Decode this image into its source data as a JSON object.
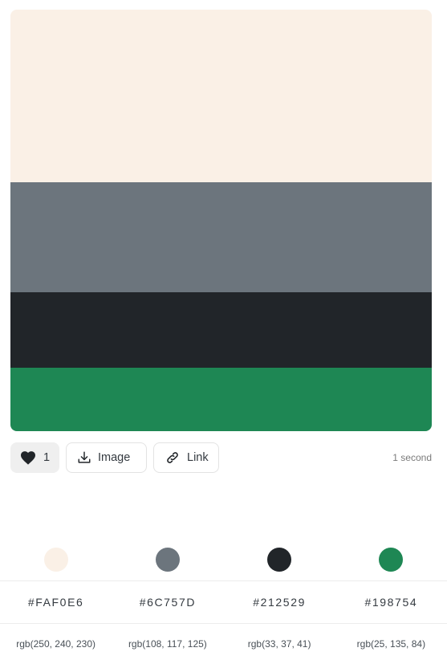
{
  "palette": {
    "colors": [
      {
        "hex": "#FAF0E6",
        "fill": "#FAF0E6",
        "rgb": "rgb(250, 240, 230)",
        "share": 0.41
      },
      {
        "hex": "#6C757D",
        "fill": "#6C757D",
        "rgb": "rgb(108, 117, 125)",
        "share": 0.26
      },
      {
        "hex": "#212529",
        "fill": "#212529",
        "rgb": "rgb(33, 37, 41)",
        "share": 0.18
      },
      {
        "hex": "#198754",
        "fill": "#1E8754",
        "rgb": "rgb(25, 135, 84)",
        "share": 0.15
      }
    ]
  },
  "actions": {
    "like_count": "1",
    "image_label": "Image",
    "link_label": "Link",
    "time_ago": "1 second",
    "icons": {
      "like": "heart-icon",
      "image": "download-icon",
      "link": "link-icon"
    }
  }
}
